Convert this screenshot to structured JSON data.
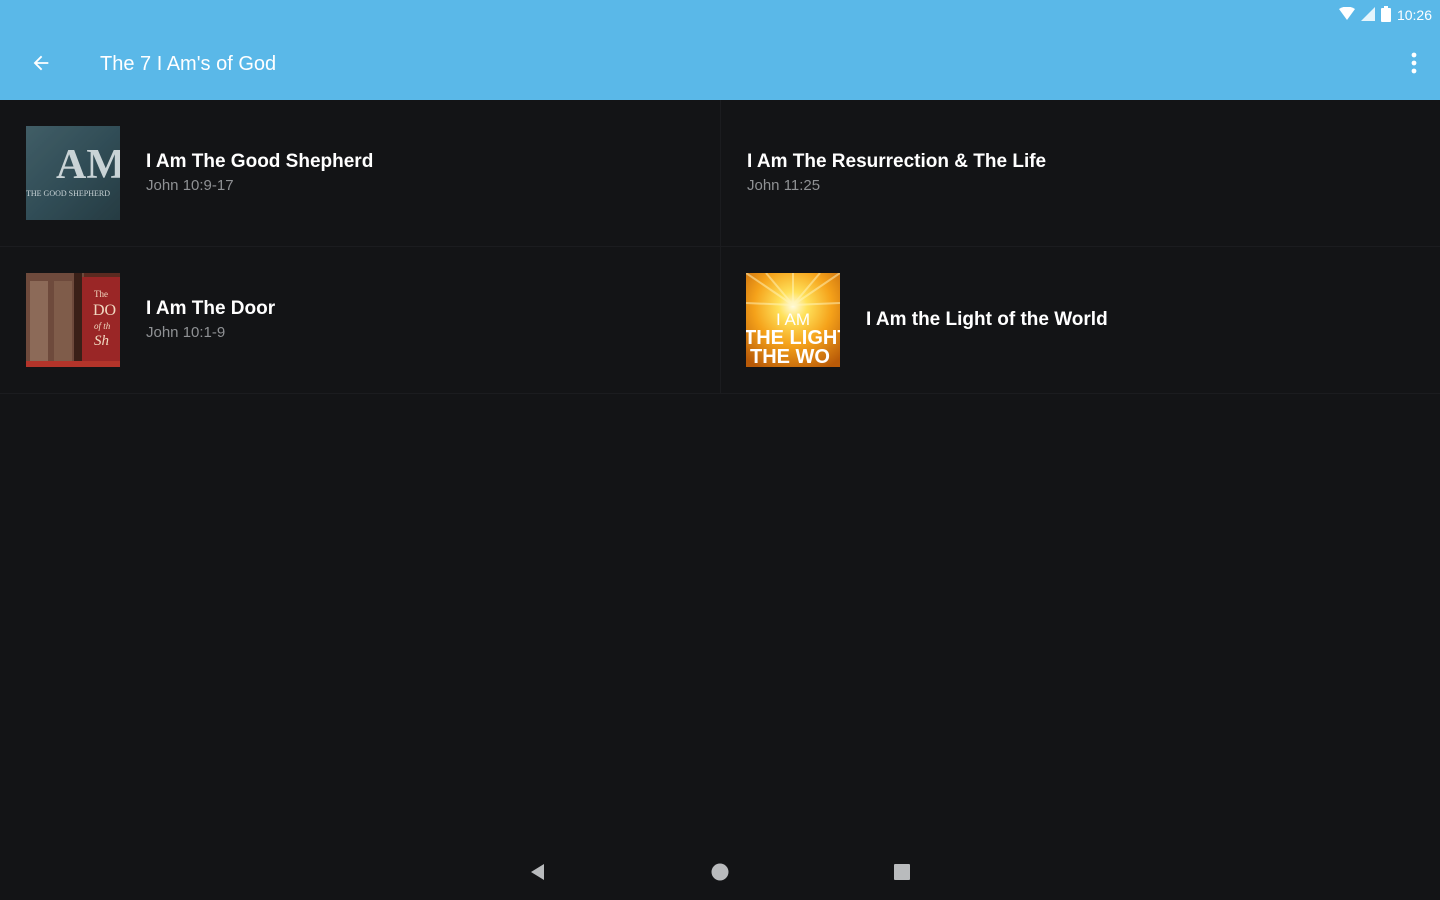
{
  "status_bar": {
    "time": "10:26"
  },
  "app_bar": {
    "title": "The 7 I Am's of God",
    "back_icon": "arrow-left-icon",
    "menu_icon": "more-vert-icon",
    "background_color": "#5ab8e8"
  },
  "items": [
    {
      "title": "I Am The Good Shepherd",
      "subtitle": "John 10:9-17",
      "thumbnail": {
        "big_text": "AM",
        "small_text": "THE GOOD SHEPHERD"
      }
    },
    {
      "title": "I  Am The Resurrection & The Life",
      "subtitle": "John 11:25"
    },
    {
      "title": "I Am The Door",
      "subtitle": "John 10:1-9",
      "thumbnail": {
        "line1": "The",
        "line2": "DO",
        "line3": "of th",
        "line4": "Sh"
      }
    },
    {
      "title": "I Am the Light of the World",
      "thumbnail": {
        "line1": "I AM",
        "line2": "THE LIGHT",
        "line3": "THE WO"
      }
    }
  ],
  "nav_bar": {
    "back": "triangle-back-icon",
    "home": "circle-home-icon",
    "recents": "square-recents-icon"
  }
}
